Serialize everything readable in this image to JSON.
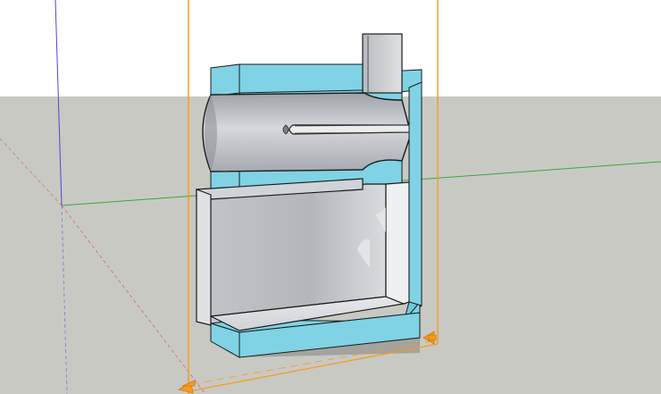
{
  "app": {
    "window_title": ""
  },
  "scene": {
    "sky_color": "#ffffff",
    "ground_color": "#c9c9c4",
    "axis_colors": {
      "red": "#d45a5a",
      "green": "#3aa83a",
      "blue": "#4a4ad8"
    },
    "section_plane_color": "#f59a1e",
    "model": {
      "cut_face_color": "#7fd3e4",
      "outer_face_color": "#6ec8d8",
      "interior_color": "#b9bcc2",
      "interior_light": "#e2e4e8",
      "edge_color": "#1a1a1a",
      "shadow_color": "#9a9a96"
    },
    "icons": [
      "section-plane-arrow-icon",
      "section-plane-arrow-icon"
    ]
  }
}
